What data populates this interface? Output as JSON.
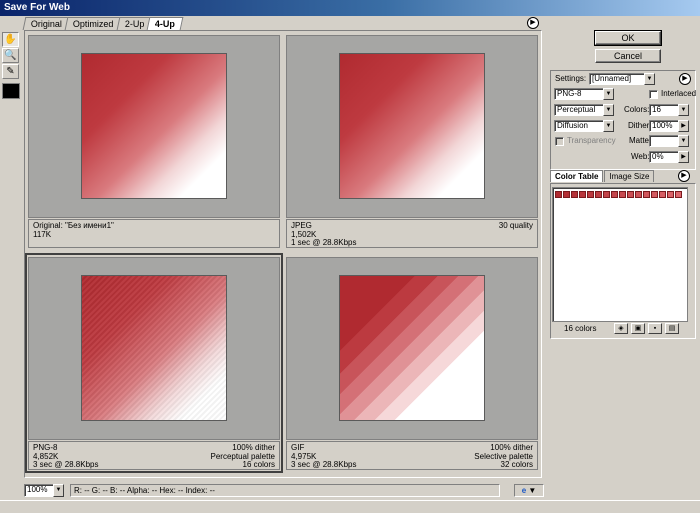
{
  "window": {
    "title": "Save For Web"
  },
  "tabs": [
    {
      "label": "Original"
    },
    {
      "label": "Optimized"
    },
    {
      "label": "2-Up"
    },
    {
      "label": "4-Up"
    }
  ],
  "tools": [
    "hand-icon",
    "zoom-icon",
    "eyedropper-icon"
  ],
  "panes": [
    {
      "left": [
        "Original: \"Без имени1\"",
        "117K",
        ""
      ],
      "right": [
        "",
        "",
        ""
      ]
    },
    {
      "left": [
        "JPEG",
        "1,502K",
        "1 sec @ 28.8Kbps"
      ],
      "right": [
        "30 quality",
        "",
        ""
      ]
    },
    {
      "left": [
        "PNG-8",
        "4,852K",
        "3 sec @ 28.8Kbps"
      ],
      "right": [
        "100% dither",
        "Perceptual palette",
        "16 colors"
      ]
    },
    {
      "left": [
        "GIF",
        "4,975K",
        "3 sec @ 28.8Kbps"
      ],
      "right": [
        "100% dither",
        "Selective palette",
        "32 colors"
      ]
    }
  ],
  "buttons": {
    "ok": "OK",
    "cancel": "Cancel"
  },
  "settings": {
    "label": "Settings:",
    "preset": "[Unnamed]",
    "format": "PNG-8",
    "reduction": "Perceptual",
    "dither_algo": "Diffusion",
    "interlaced_label": "Interlaced",
    "transparency_label": "Transparency",
    "colors_label": "Colors:",
    "colors_value": "16",
    "dither_label": "Dither:",
    "dither_value": "100%",
    "matte_label": "Matte:",
    "web_label": "Web:",
    "web_value": "0%"
  },
  "color_table": {
    "tab_color_table": "Color Table",
    "tab_image_size": "Image Size",
    "count_label": "16 colors",
    "swatches": [
      "#b02a30",
      "#b32e34",
      "#b63238",
      "#b9363c",
      "#bc3a40",
      "#bf3e44",
      "#c24248",
      "#c5464c",
      "#c84a50",
      "#cb4e54",
      "#ce5258",
      "#d1565c",
      "#d45a60",
      "#d75e64",
      "#da6268",
      "#dd666c"
    ]
  },
  "statusbar": {
    "zoom": "100%",
    "readout": "R: -- G: -- B: -- Alpha: -- Hex: -- Index: --"
  }
}
